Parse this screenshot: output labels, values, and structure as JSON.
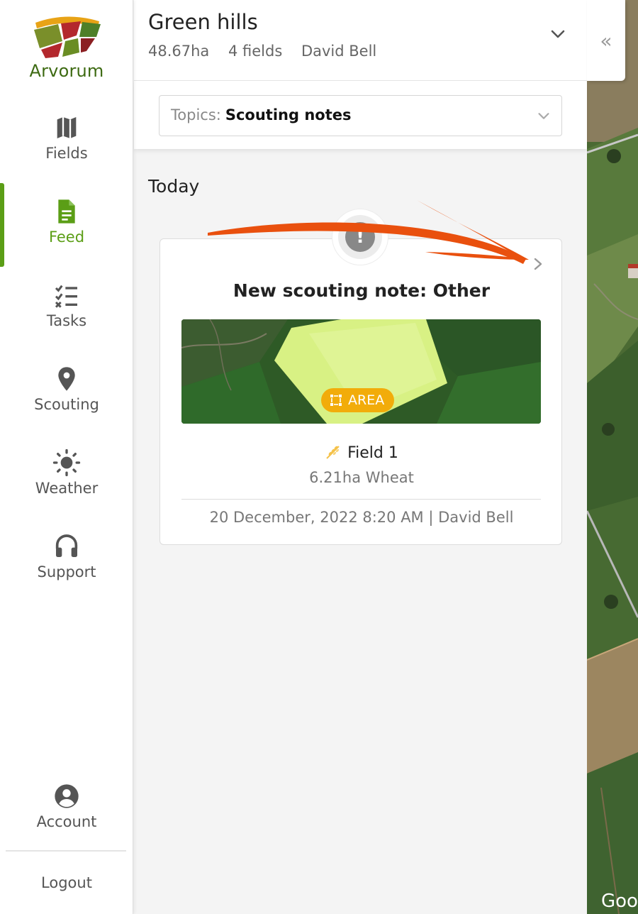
{
  "brand": {
    "name": "Arvorum"
  },
  "nav": {
    "items": [
      {
        "id": "fields",
        "label": "Fields",
        "icon": "map-icon",
        "active": false
      },
      {
        "id": "feed",
        "label": "Feed",
        "icon": "document-icon",
        "active": true
      },
      {
        "id": "tasks",
        "label": "Tasks",
        "icon": "checklist-icon",
        "active": false
      },
      {
        "id": "scouting",
        "label": "Scouting",
        "icon": "location-pin-icon",
        "active": false
      },
      {
        "id": "weather",
        "label": "Weather",
        "icon": "sun-icon",
        "active": false
      },
      {
        "id": "support",
        "label": "Support",
        "icon": "headset-icon",
        "active": false
      }
    ],
    "account": {
      "label": "Account",
      "icon": "account-circle-icon"
    },
    "logout": {
      "label": "Logout"
    }
  },
  "farm": {
    "name": "Green hills",
    "area": "48.67ha",
    "fields": "4 fields",
    "owner": "David Bell"
  },
  "filter": {
    "label": "Topics:",
    "value": "Scouting notes"
  },
  "feed": {
    "section": "Today",
    "card": {
      "title": "New scouting note: Other",
      "badge": "AREA",
      "field_name": "Field 1",
      "field_details": "6.21ha Wheat",
      "footer": "20 December, 2022 8:20 AM | David Bell",
      "alert_icon": "!"
    }
  },
  "map": {
    "watermark": "Goo"
  },
  "colors": {
    "accent": "#5b9e16",
    "badge": "#f2ac0a",
    "annotation": "#e9500e"
  }
}
